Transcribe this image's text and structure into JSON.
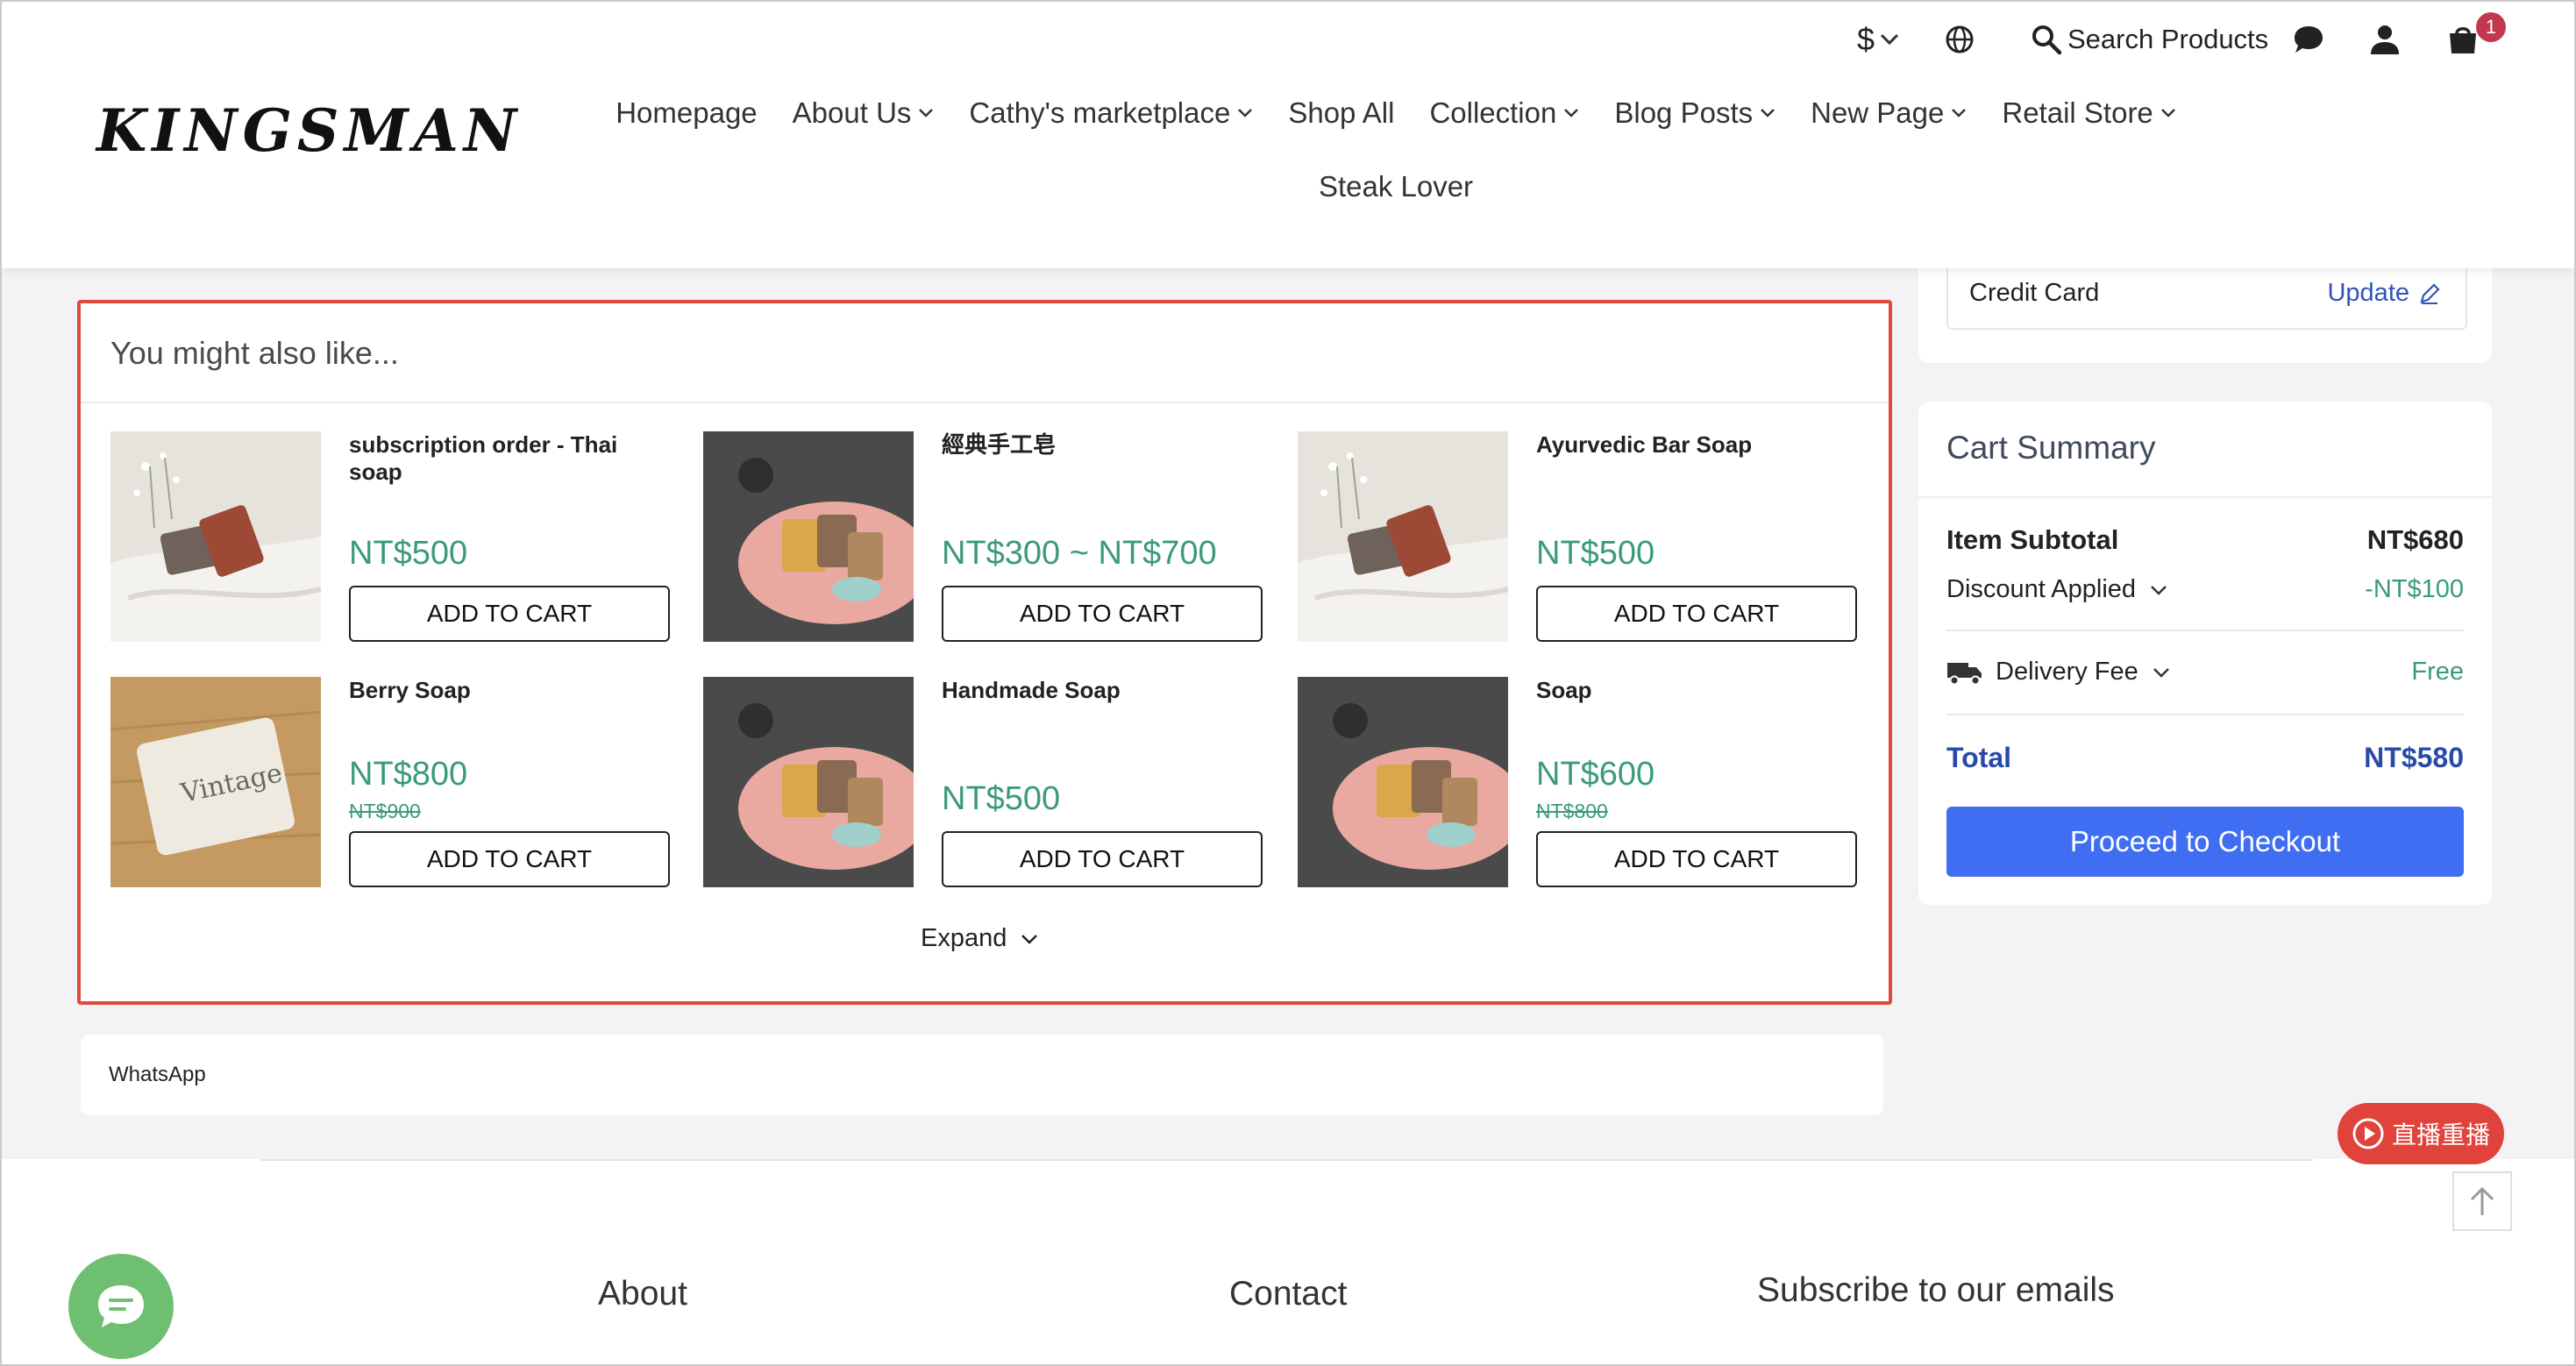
{
  "header": {
    "logo": "KINGSMAN",
    "currency_symbol": "$",
    "search_label": "Search Products",
    "cart_count": "1"
  },
  "nav": {
    "items": [
      {
        "label": "Homepage",
        "dropdown": false
      },
      {
        "label": "About Us",
        "dropdown": true
      },
      {
        "label": "Cathy's marketplace",
        "dropdown": true
      },
      {
        "label": "Shop All",
        "dropdown": false
      },
      {
        "label": "Collection",
        "dropdown": true
      },
      {
        "label": "Blog Posts",
        "dropdown": true
      },
      {
        "label": "New Page",
        "dropdown": true
      },
      {
        "label": "Retail Store",
        "dropdown": true
      }
    ],
    "second_row": "Steak Lover"
  },
  "recommendations": {
    "title": "You might also like...",
    "button_label": "ADD TO CART",
    "expand_label": "Expand",
    "products": [
      {
        "name": "subscription order - Thai soap",
        "price": "NT$500",
        "old_price": ""
      },
      {
        "name": "經典手工皂",
        "price": "NT$300 ~ NT$700",
        "old_price": ""
      },
      {
        "name": "Ayurvedic Bar Soap",
        "price": "NT$500",
        "old_price": ""
      },
      {
        "name": "Berry Soap",
        "price": "NT$800",
        "old_price": "NT$900"
      },
      {
        "name": "Handmade Soap",
        "price": "NT$500",
        "old_price": ""
      },
      {
        "name": "Soap",
        "price": "NT$600",
        "old_price": "NT$800"
      }
    ]
  },
  "whatsapp": {
    "label": "WhatsApp"
  },
  "payment": {
    "method": "Credit Card",
    "update_label": "Update"
  },
  "summary": {
    "title": "Cart Summary",
    "subtotal_label": "Item Subtotal",
    "subtotal": "NT$680",
    "discount_label": "Discount Applied",
    "discount": "-NT$100",
    "delivery_label": "Delivery Fee",
    "delivery": "Free",
    "total_label": "Total",
    "total": "NT$580",
    "checkout_label": "Proceed to Checkout"
  },
  "footer": {
    "about": "About",
    "contact": "Contact",
    "subscribe": "Subscribe to our emails"
  },
  "live_replay": "直播重播",
  "colors": {
    "accent": "#3f6ef2",
    "price": "#3b9a7c",
    "highlight": "#e04a3a",
    "total": "#2a4aa8"
  }
}
